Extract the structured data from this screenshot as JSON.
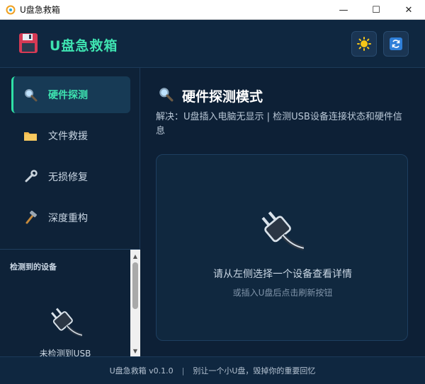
{
  "window": {
    "title": "U盘急救箱",
    "minimize_glyph": "—",
    "maximize_glyph": "☐",
    "close_glyph": "✕"
  },
  "header": {
    "brand": "U盘急救箱",
    "logo_icon": "floppy-disk-icon",
    "theme_icon": "sun-icon",
    "refresh_icon": "refresh-icon"
  },
  "sidebar": {
    "nav": [
      {
        "label": "硬件探测",
        "icon": "magnifier-icon",
        "active": true
      },
      {
        "label": "文件救援",
        "icon": "folder-icon",
        "active": false
      },
      {
        "label": "无损修复",
        "icon": "wrench-icon",
        "active": false
      },
      {
        "label": "深度重构",
        "icon": "hammer-icon",
        "active": false
      }
    ],
    "devices_title": "检测到的设备",
    "devices_empty": "未检测到USB"
  },
  "main": {
    "title": "硬件探测模式",
    "description": "解决：U盘插入电脑无显示 | 检测USB设备连接状态和硬件信息",
    "panel_primary": "请从左侧选择一个设备查看详情",
    "panel_secondary": "或插入U盘后点击刷新按钮"
  },
  "footer": {
    "version": "U盘急救箱 v0.1.0",
    "separator": "|",
    "slogan": "别让一个小U盘，毁掉你的重要回忆"
  },
  "colors": {
    "accent": "#3ee3b0",
    "background": "#0d2036",
    "panel": "#10283f"
  }
}
